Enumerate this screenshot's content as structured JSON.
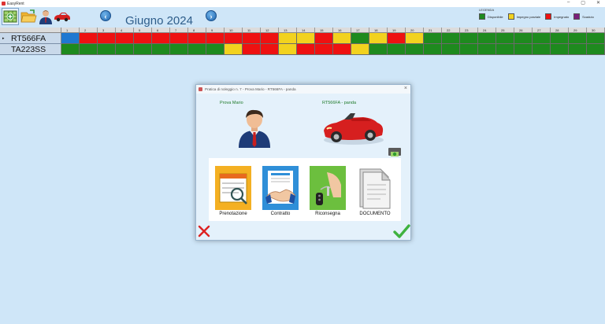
{
  "window": {
    "title": "EasyRent",
    "controls": [
      "–",
      "▢",
      "✕"
    ]
  },
  "toolbar": {
    "buttons": [
      {
        "name": "rentals-button",
        "icon": "grid-add-icon"
      },
      {
        "name": "open-folder-button",
        "icon": "folder-icon"
      },
      {
        "name": "customers-button",
        "icon": "person-icon"
      },
      {
        "name": "vehicles-button",
        "icon": "car-icon"
      }
    ],
    "prev": "‹",
    "next": "›",
    "month_title": "Giugno 2024"
  },
  "legend": {
    "title": "LEGENDA",
    "items": [
      {
        "label": "Disponibile",
        "color": "#1e8a1e"
      },
      {
        "label": "Impegno parziale",
        "color": "#f2d21f"
      },
      {
        "label": "Impegnato",
        "color": "#ee1111"
      },
      {
        "label": "Scaduto",
        "color": "#7a1e7a"
      }
    ]
  },
  "grid": {
    "days": [
      "1",
      "2",
      "3",
      "4",
      "5",
      "6",
      "7",
      "8",
      "9",
      "10",
      "11",
      "12",
      "13",
      "14",
      "15",
      "16",
      "17",
      "18",
      "19",
      "20",
      "21",
      "22",
      "23",
      "24",
      "25",
      "26",
      "27",
      "28",
      "29",
      "30"
    ],
    "rows": [
      {
        "plate": "RT566FA",
        "selected_marker": "▸",
        "cells": [
          "B",
          "R",
          "R",
          "R",
          "R",
          "R",
          "R",
          "R",
          "R",
          "R",
          "R",
          "R",
          "Y",
          "Y",
          "R",
          "Y",
          "G",
          "Y",
          "R",
          "Y",
          "G",
          "G",
          "G",
          "G",
          "G",
          "G",
          "G",
          "G",
          "G",
          "G"
        ]
      },
      {
        "plate": "TA223SS",
        "selected_marker": "",
        "cells": [
          "G",
          "G",
          "G",
          "G",
          "G",
          "G",
          "G",
          "G",
          "G",
          "Y",
          "R",
          "R",
          "Y",
          "R",
          "R",
          "R",
          "Y",
          "G",
          "G",
          "G",
          "G",
          "G",
          "G",
          "G",
          "G",
          "G",
          "G",
          "G",
          "G",
          "G"
        ]
      }
    ],
    "cell_colors": {
      "G": "#1e8a1e",
      "Y": "#f2d21f",
      "R": "#ee1111",
      "B": "#1f78d1"
    }
  },
  "modal": {
    "title": "Pratica di noleggio n. 7 - Prova Mario - RT566FA - panda",
    "close": "×",
    "person_name": "Prova Mario",
    "car_name": "RT566FA - panda",
    "actions": [
      {
        "label": "Prenotazione",
        "icon": "booking-calendar-icon"
      },
      {
        "label": "Contratto",
        "icon": "contract-handshake-icon"
      },
      {
        "label": "Riconsegna",
        "icon": "car-keys-icon"
      },
      {
        "label": "DOCUMENTO",
        "icon": "document-icon"
      }
    ]
  }
}
